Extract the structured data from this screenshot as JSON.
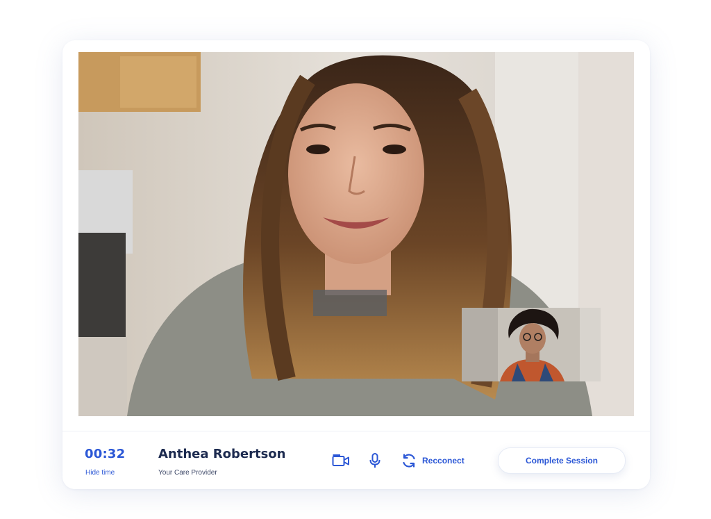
{
  "session": {
    "timer": "00:32",
    "hide_time_label": "Hide time"
  },
  "provider": {
    "name": "Anthea Robertson",
    "role": "Your Care Provider"
  },
  "controls": {
    "camera_icon": "video-camera-icon",
    "mic_icon": "microphone-icon",
    "reconnect_icon": "refresh-icon",
    "reconnect_label": "Recconect",
    "complete_label": "Complete Session"
  },
  "colors": {
    "accent": "#2b57d6",
    "name_text": "#1c2a4f"
  }
}
